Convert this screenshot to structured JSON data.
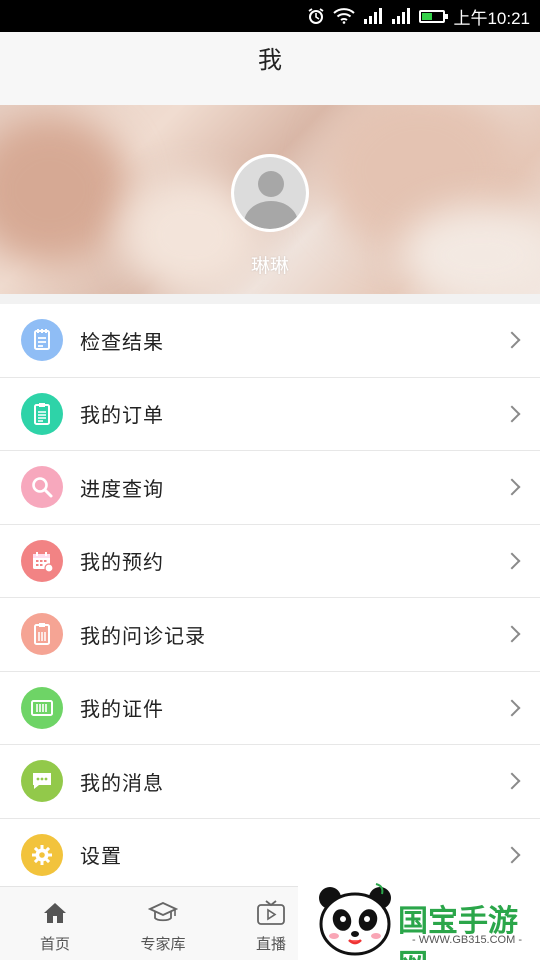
{
  "status_bar": {
    "time": "上午10:21",
    "signal_1": "ııl",
    "signal_2": "ııl"
  },
  "header": {
    "title": "我"
  },
  "profile": {
    "username": "琳琳"
  },
  "menu": {
    "items": [
      {
        "label": "检查结果",
        "icon": "report-icon",
        "color": "#8fbdf5"
      },
      {
        "label": "我的订单",
        "icon": "order-clipboard-icon",
        "color": "#2ed3a8"
      },
      {
        "label": "进度查询",
        "icon": "search-icon",
        "color": "#f7a8bd"
      },
      {
        "label": "我的预约",
        "icon": "calendar-icon",
        "color": "#f28384"
      },
      {
        "label": "我的问诊记录",
        "icon": "record-clipboard-icon",
        "color": "#f5a494"
      },
      {
        "label": "我的证件",
        "icon": "id-card-icon",
        "color": "#6ed466"
      },
      {
        "label": "我的消息",
        "icon": "message-icon",
        "color": "#92c94a"
      },
      {
        "label": "设置",
        "icon": "gear-icon",
        "color": "#f2c33c"
      }
    ]
  },
  "tabbar": {
    "tabs": [
      {
        "label": "首页",
        "icon": "home-icon"
      },
      {
        "label": "专家库",
        "icon": "graduation-cap-icon"
      },
      {
        "label": "直播",
        "icon": "tv-play-icon"
      }
    ]
  },
  "watermark": {
    "brand": "国宝手游网",
    "url": "- WWW.GB315.COM -"
  },
  "colors": {
    "battery_fill": "#35d04a",
    "watermark_green": "#2ba64a"
  }
}
